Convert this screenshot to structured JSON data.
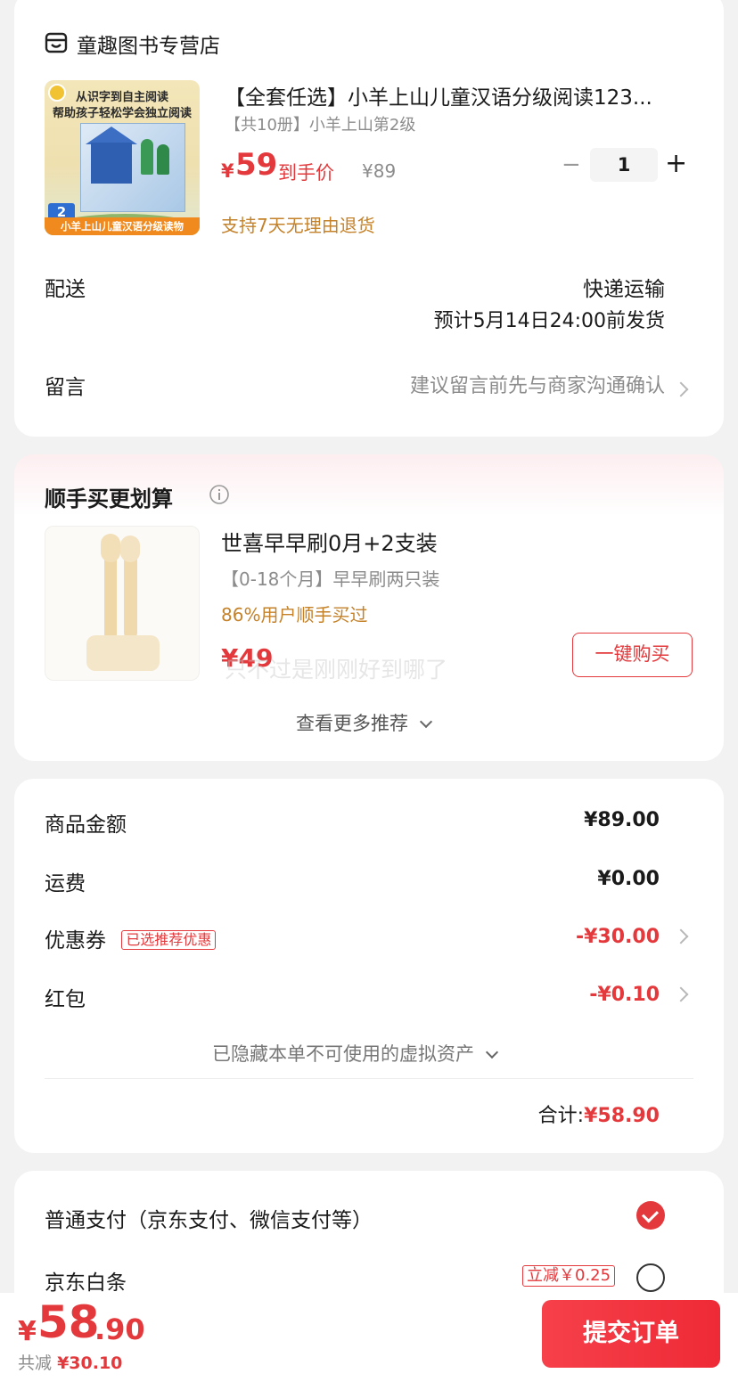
{
  "store": {
    "icon": "store-icon",
    "name": "童趣图书专营店"
  },
  "product": {
    "cover_line1": "从识字到自主阅读",
    "cover_line2": "帮助孩子轻松学会独立阅读",
    "cover_level": "2",
    "cover_band": "小羊上山儿童汉语分级读物",
    "title": "【全套任选】小羊上山儿童汉语分级阅读123...",
    "spec": "【共10册】小羊上山第2级",
    "currency": "¥",
    "price": "59",
    "price_label": "到手价",
    "original_price": "¥89",
    "qty": "1",
    "minus": "−",
    "plus": "+",
    "service": "支持7天无理由退货"
  },
  "delivery": {
    "label": "配送",
    "method": "快递运输",
    "eta": "预计5月14日24:00前发货"
  },
  "message": {
    "label": "留言",
    "placeholder": "建议留言前先与商家沟通确认"
  },
  "recommend": {
    "title": "顺手买更划算",
    "info_icon": "info-icon",
    "item_name": "世喜早早刷0月+2支装",
    "item_spec": "【0-18个月】早早刷两只装",
    "item_stat": "86%用户顺手买过",
    "item_price": "¥49",
    "buy_label": "一键购买",
    "more_label": "查看更多推荐",
    "overlay_text": "只不过是刚刚好到哪了"
  },
  "summary": {
    "goods_label": "商品金额",
    "goods_value": "¥89.00",
    "shipping_label": "运费",
    "shipping_value": "¥0.00",
    "coupon_label": "优惠券",
    "coupon_tag": "已选推荐优惠",
    "coupon_value": "-¥30.00",
    "redpacket_label": "红包",
    "redpacket_value": "-¥0.10",
    "hidden_assets": "已隐藏本单不可使用的虚拟资产",
    "total_label": "合计:",
    "total_value": "¥58.90"
  },
  "payment": {
    "normal_label": "普通支付（京东支付、微信支付等）",
    "baitiao_label": "京东白条",
    "baitiao_tag": "立减￥0.25"
  },
  "footer": {
    "currency": "¥",
    "amount_int": "58",
    "amount_dec": ".90",
    "saved_label": "共减",
    "saved_value": "¥30.10",
    "submit_label": "提交订单"
  },
  "colors": {
    "accent": "#e4393c",
    "orange_text": "#c4822b"
  }
}
